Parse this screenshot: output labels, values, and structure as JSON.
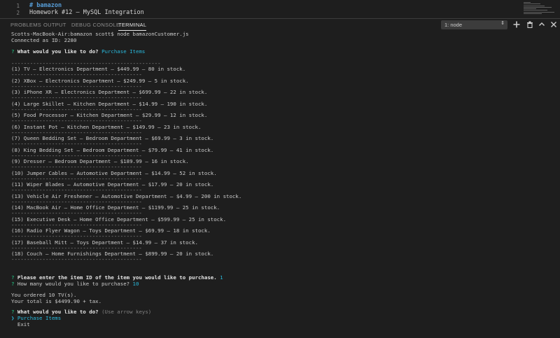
{
  "editor": {
    "lines": [
      {
        "number": "1",
        "text": "# bamazon"
      },
      {
        "number": "2",
        "text": "Homework #12 – MySQL Integration"
      }
    ]
  },
  "panel": {
    "tabs": [
      {
        "label": "PROBLEMS",
        "active": false
      },
      {
        "label": "OUTPUT",
        "active": false
      },
      {
        "label": "DEBUG CONSOLE",
        "active": false
      },
      {
        "label": "TERMINAL",
        "active": true
      }
    ],
    "terminal_select": "1: node",
    "icons": [
      "add-terminal-icon",
      "trash-icon",
      "split-terminal-icon",
      "chevron-up-icon",
      "close-icon"
    ]
  },
  "terminal": {
    "prompt_line": "Scotts-MacBook-Air:bamazon scott$ node bamazonCustomer.js",
    "connected": "Connected as ID: 2280",
    "q1_mark": "?",
    "q1_text": "What would you like to do?",
    "q1_answer": "Purchase Items",
    "separator_long": "------------------------------------------------",
    "separator_short": "------------------------------------------",
    "items": [
      "(1) TV – Electronics Department – $449.99 – 80 in stock.",
      "(2) XBox – Electronics Department – $249.99 – 5 in stock.",
      "(3) iPhone XR – Electronics Department – $699.99 – 22 in stock.",
      "(4) Large Skillet – Kitchen Department – $14.99 – 190 in stock.",
      "(5) Food Processor – Kitchen Department – $29.99 – 12 in stock.",
      "(6) Instant Pot – Kitchen Department – $149.99 – 23 in stock.",
      "(7) Queen Bedding Set – Bedroom Department – $69.99 – 3 in stock.",
      "(8) King Bedding Set – Bedroom Department – $79.99 – 41 in stock.",
      "(9) Dresser – Bedroom Department – $189.99 – 16 in stock.",
      "(10) Jumper Cables – Automotive Department – $14.99 – 52 in stock.",
      "(11) Wiper Blades – Automotive Department – $17.99 – 20 in stock.",
      "(13) Vehicle Air Freshener – Automotive Department – $4.99 – 200 in stock.",
      "(14) MacBook Air – Home Office Department – $1199.99 – 25 in stock.",
      "(15) Executive Desk – Home Office Department – $599.99 – 25 in stock.",
      "(16) Radio Flyer Wagon – Toys Department – $69.99 – 18 in stock.",
      "(17) Baseball Mitt – Toys Department – $14.99 – 37 in stock.",
      "(18) Couch – Home Furnishings Department – $899.99 – 20 in stock."
    ],
    "q2_mark": "?",
    "q2_text": "Please enter the item ID of the item you would like to purchase.",
    "q2_answer": "1",
    "q3_mark": "?",
    "q3_text": "How many would you like to purchase?",
    "q3_answer": "10",
    "ordered": "You ordered 10 TV(s).",
    "total": "Your total is $4499.90 + tax.",
    "q4_mark": "?",
    "q4_text": "What would you like to do?",
    "q4_hint": "(Use arrow keys)",
    "choice_pointer": "❯",
    "choices": [
      "Purchase Items",
      "Exit"
    ]
  },
  "colors": {
    "background": "#1e1e1e",
    "prompt_green": "#23d18b",
    "answer_cyan": "#29b8db",
    "line_number": "#858585",
    "heading_blue": "#569cd6"
  }
}
